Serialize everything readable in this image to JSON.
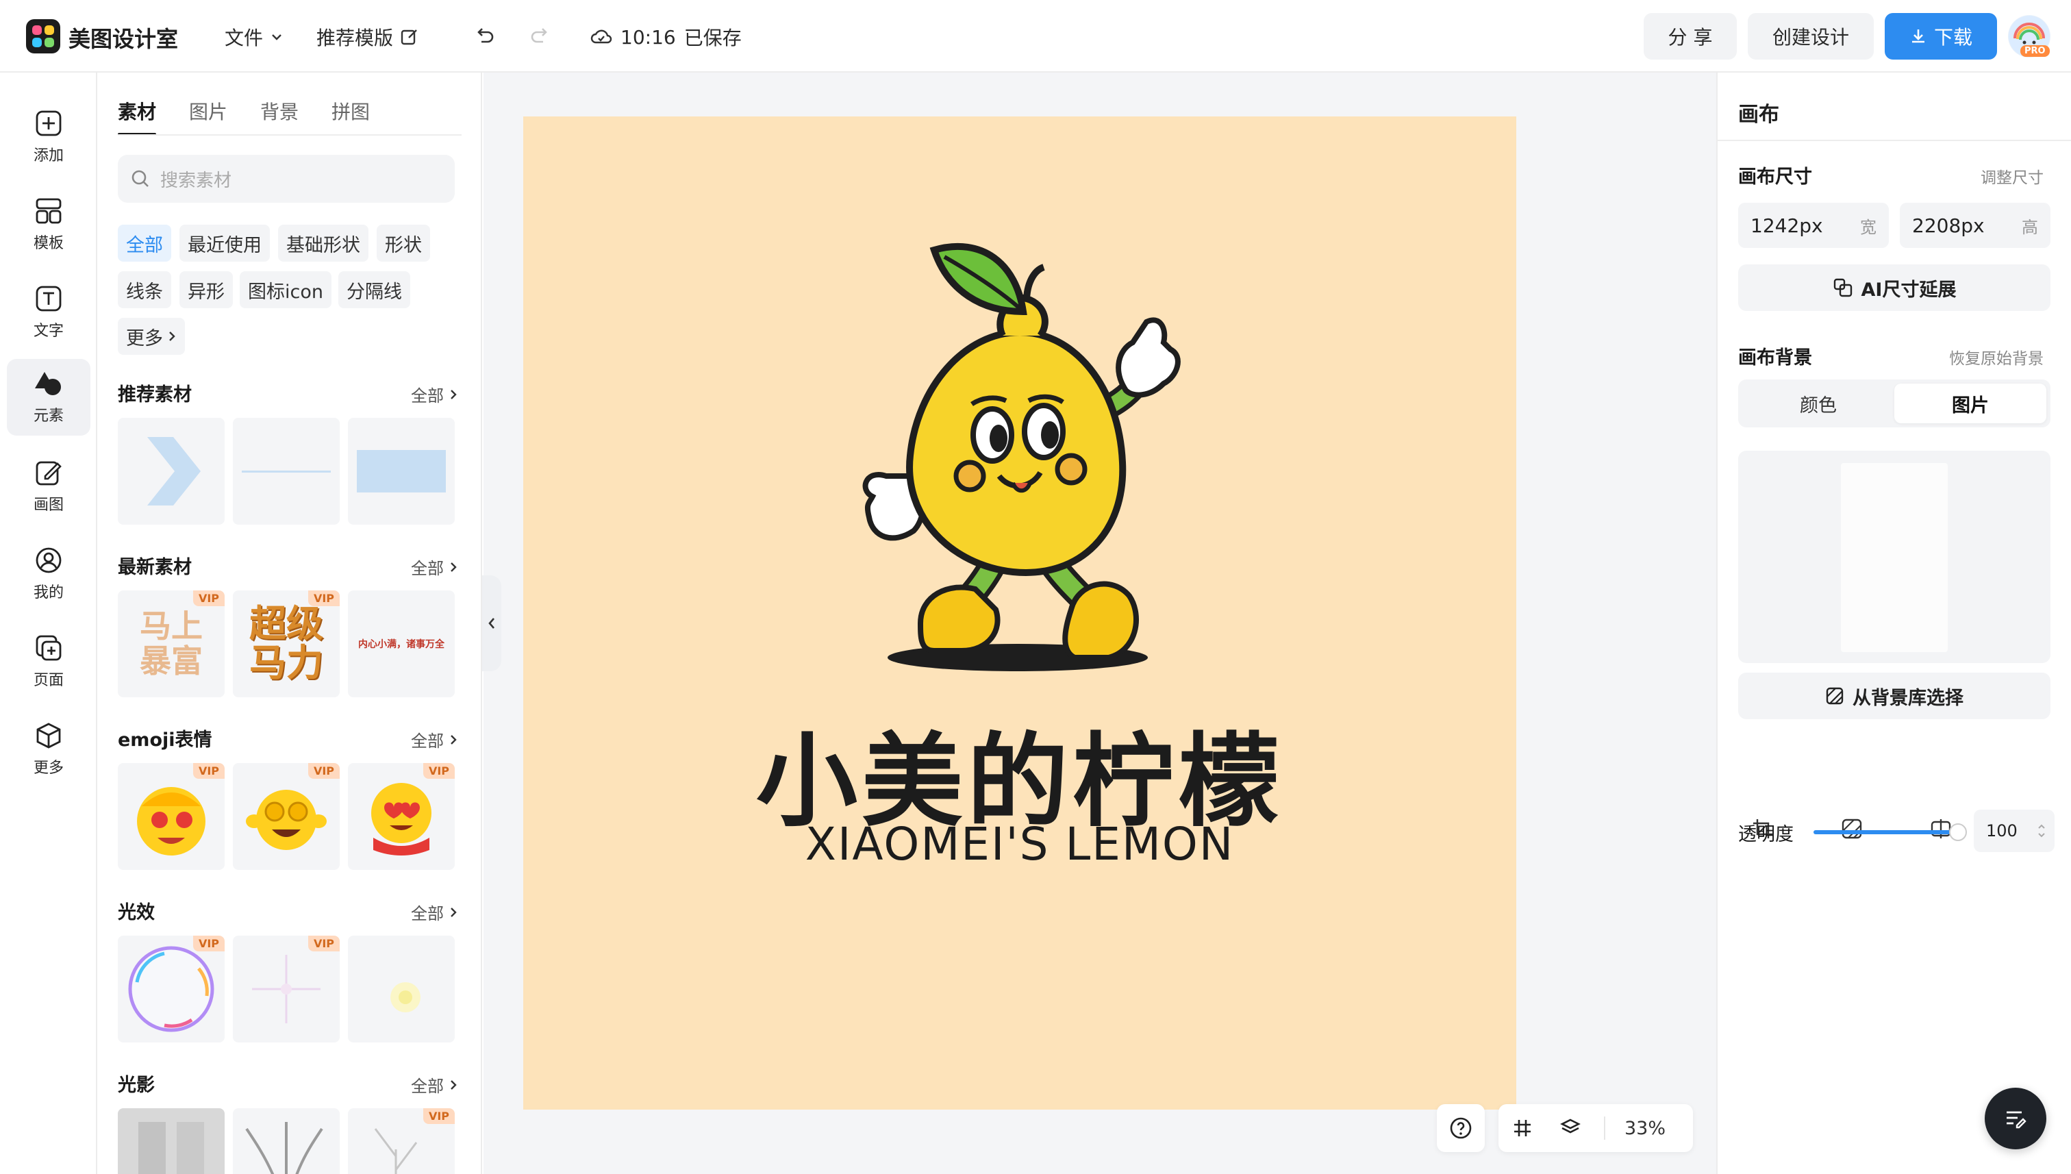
{
  "header": {
    "brand": "美图设计室",
    "file_menu": "文件",
    "template_label": "推荐模版",
    "save_time": "10:16",
    "save_status": "已保存",
    "share": "分 享",
    "create": "创建设计",
    "download": "下载",
    "pro_badge": "PRO"
  },
  "rail": [
    {
      "label": "添加",
      "icon": "add-icon"
    },
    {
      "label": "模板",
      "icon": "template-icon"
    },
    {
      "label": "文字",
      "icon": "text-icon"
    },
    {
      "label": "元素",
      "icon": "element-icon"
    },
    {
      "label": "画图",
      "icon": "draw-icon"
    },
    {
      "label": "我的",
      "icon": "user-icon"
    },
    {
      "label": "页面",
      "icon": "page-icon"
    },
    {
      "label": "更多",
      "icon": "more-icon"
    }
  ],
  "panel": {
    "tabs": [
      "素材",
      "图片",
      "背景",
      "拼图"
    ],
    "search_placeholder": "搜索素材",
    "chips": [
      "全部",
      "最近使用",
      "基础形状",
      "形状",
      "线条",
      "异形",
      "图标icon",
      "分隔线",
      "更多"
    ],
    "sections": [
      {
        "title": "推荐素材",
        "all": "全部"
      },
      {
        "title": "最新素材",
        "all": "全部"
      },
      {
        "title": "emoji表情",
        "all": "全部"
      },
      {
        "title": "光效",
        "all": "全部"
      },
      {
        "title": "光影",
        "all": "全部"
      }
    ],
    "vip": "VIP",
    "thumb_texts": {
      "mashang": "马上\n暴富",
      "chaoji": "超级\n马力",
      "slogan": "内心小满，诸事万全"
    }
  },
  "canvas": {
    "title_cn": "小美的柠檬",
    "title_en": "XIAOMEI'S LEMON",
    "zoom": "33%",
    "background": "#fde3ba"
  },
  "right": {
    "title": "画布",
    "size_label": "画布尺寸",
    "resize_link": "调整尺寸",
    "width_value": "1242px",
    "width_unit": "宽",
    "height_value": "2208px",
    "height_unit": "高",
    "ai_extend": "AI尺寸延展",
    "bg_label": "画布背景",
    "restore_link": "恢复原始背景",
    "seg_color": "颜色",
    "seg_image": "图片",
    "from_library": "从背景库选择",
    "opacity_label": "透明度",
    "opacity_value": "100",
    "opacity_level": 1.0
  },
  "colors": {
    "accent": "#2d8cf0",
    "canvas_bg": "#fde3ba",
    "lemon": "#f7d32a"
  }
}
